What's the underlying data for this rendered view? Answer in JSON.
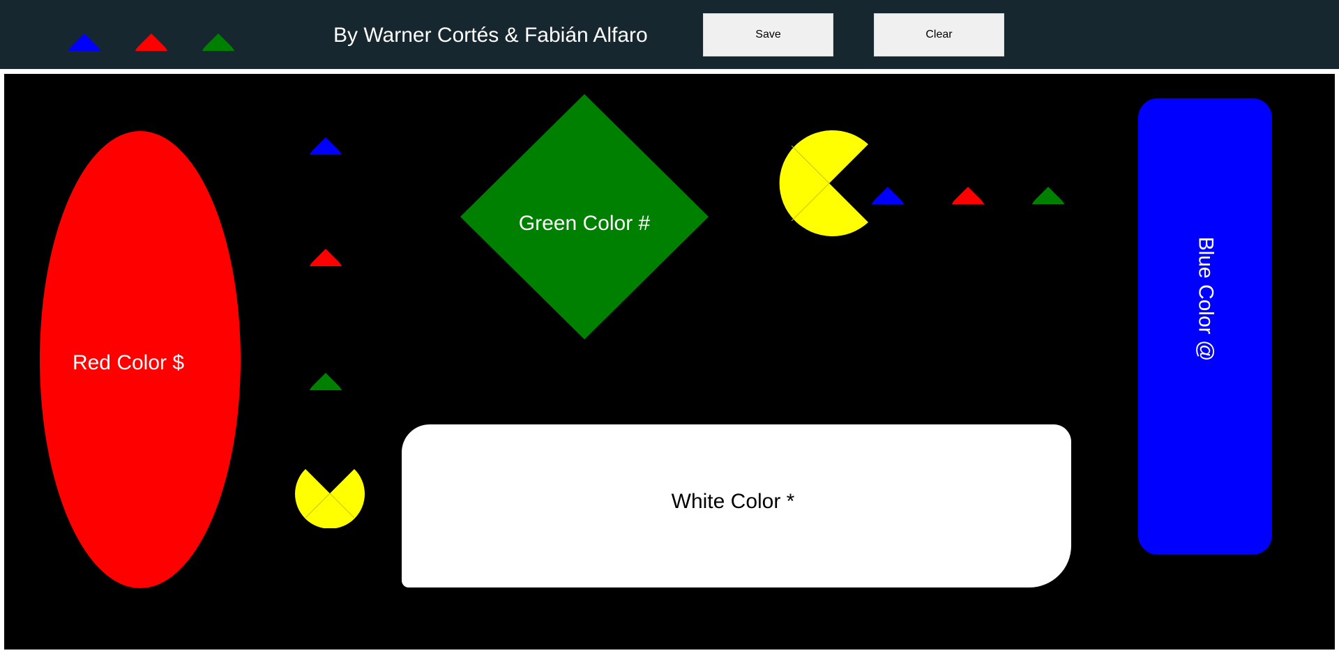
{
  "header": {
    "credits": "By Warner Cortés & Fabián Alfaro",
    "save_label": "Save",
    "clear_label": "Clear",
    "background": "#17272f"
  },
  "palette": {
    "blue": "#0000ff",
    "red": "#ff0000",
    "green": "#008000",
    "yellow": "#ffff00",
    "white": "#ffffff",
    "canvas": "#000000"
  },
  "header_pacmen": [
    {
      "color": "blue",
      "icon": "blue-pacman-icon"
    },
    {
      "color": "red",
      "icon": "red-pacman-icon"
    },
    {
      "color": "green",
      "icon": "green-pacman-icon"
    }
  ],
  "canvas": {
    "shapes": [
      {
        "kind": "ellipse",
        "color": "red",
        "label": "Red Color $"
      },
      {
        "kind": "diamond",
        "color": "green",
        "label": "Green Color #"
      },
      {
        "kind": "rounded-rectangle",
        "color": "white",
        "label": "White Color *"
      },
      {
        "kind": "pill",
        "color": "blue",
        "label": "Blue Color @"
      }
    ],
    "pacmen": [
      {
        "color": "blue",
        "facing": "down"
      },
      {
        "color": "red",
        "facing": "down"
      },
      {
        "color": "green",
        "facing": "down"
      },
      {
        "color": "yellow",
        "facing": "up"
      },
      {
        "color": "yellow",
        "facing": "right"
      },
      {
        "color": "blue",
        "facing": "down"
      },
      {
        "color": "red",
        "facing": "down"
      },
      {
        "color": "green",
        "facing": "down"
      }
    ]
  }
}
